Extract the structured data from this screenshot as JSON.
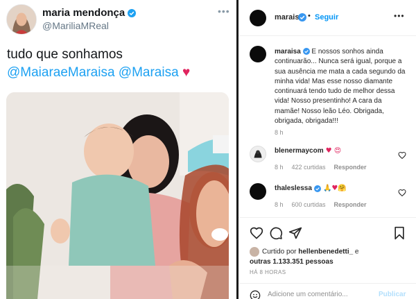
{
  "tweet": {
    "author_name": "maria mendonça",
    "author_handle": "@MariliaMReal",
    "more": "•••",
    "text_prefix": "tudo que sonhamos ",
    "mention_1": "@MaiaraeMaraisa",
    "mention_2": "@Maraisa",
    "heart": "♥"
  },
  "post": {
    "username": "maraisa",
    "dot": "•",
    "follow_label": "Seguir",
    "more": "•••",
    "caption_user": "maraisa",
    "caption_text": "E nossos sonhos ainda continuarão... Nunca será igual, porque a sua ausência me mata a cada segundo da minha vida! Mas esse nosso diamante continuará tendo tudo de melhor dessa vida! Nosso presentinho! A cara da mamãe! Nosso leão Léo. Obrigada, obrigada, obrigada!!!",
    "caption_time": "8 h",
    "comments": [
      {
        "user": "blenermaycom",
        "emoji": "♥ 😍",
        "time": "8 h",
        "likes": "422 curtidas",
        "reply": "Responder"
      },
      {
        "user": "thaleslessa",
        "emoji": "🙏♥🤗",
        "time": "8 h",
        "likes": "600 curtidas",
        "reply": "Responder"
      }
    ],
    "liked_prefix": "Curtido por ",
    "liked_user": "hellenbenedetti_",
    "liked_mid": " e ",
    "liked_others": "outras 1.133.351 pessoas",
    "post_time": "HÁ 8 HORAS",
    "comment_placeholder": "Adicione um comentário...",
    "publish_label": "Publicar"
  },
  "colors": {
    "accent": "#0095f6",
    "twitter_link": "#1da1f2",
    "heart": "#e0245e"
  }
}
